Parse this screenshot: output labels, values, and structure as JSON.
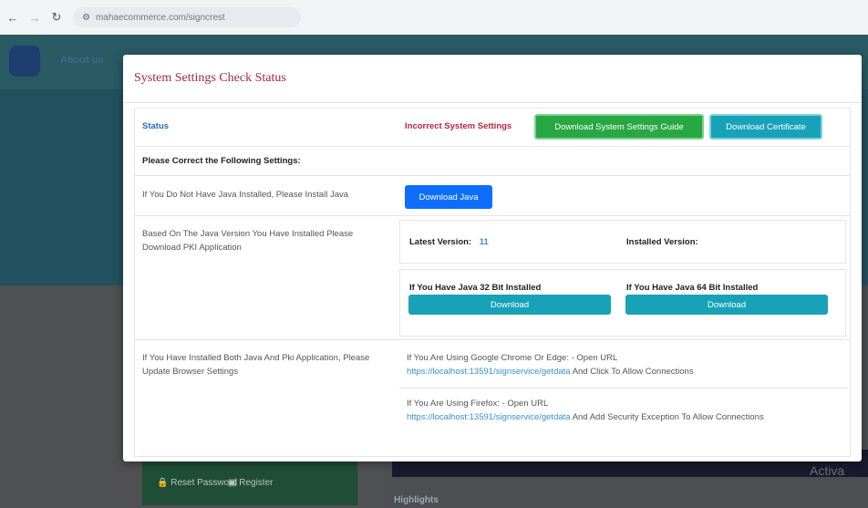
{
  "browser": {
    "url": "mahaecommerce.com/signcrest"
  },
  "background": {
    "nav_about": "About us",
    "reset_password": "Reset Password",
    "register": "Register",
    "highlights": "Highlights",
    "activate": "Activa"
  },
  "modal": {
    "title": "System Settings Check Status",
    "status_label": "Status",
    "incorrect_label": "Incorrect System Settings",
    "download_guide_button": "Download System Settings Guide",
    "download_certificate_button": "Download Certificate",
    "correct_heading": "Please Correct the Following Settings:",
    "java_row": {
      "text": "If You Do Not Have Java Installed, Please Install Java",
      "button": "Download Java"
    },
    "pki_row": {
      "text": "Based On The Java Version You Have Installed Please Download PKI Application",
      "latest_label": "Latest Version:",
      "latest_value": "11",
      "installed_label": "Installed Version:",
      "java32_label": "If You Have Java 32 Bit Installed",
      "java32_button": "Download",
      "java64_label": "If You Have Java 64 Bit Installed",
      "java64_button": "Download"
    },
    "browser_row": {
      "text": "If You Have Installed Both Java And Pki Application, Please Update Browser Settings",
      "chrome_text": "If You Are Using Google Chrome Or Edge: - Open URL",
      "chrome_url": "https://localhost:13591/signservice/getdata",
      "chrome_suffix": "And Click To Allow Connections",
      "firefox_text": "If You Are Using Firefox: - Open URL",
      "firefox_url": "https://localhost:13591/signservice/getdata",
      "firefox_suffix": "And Add Security Exception To Allow Connections"
    }
  }
}
